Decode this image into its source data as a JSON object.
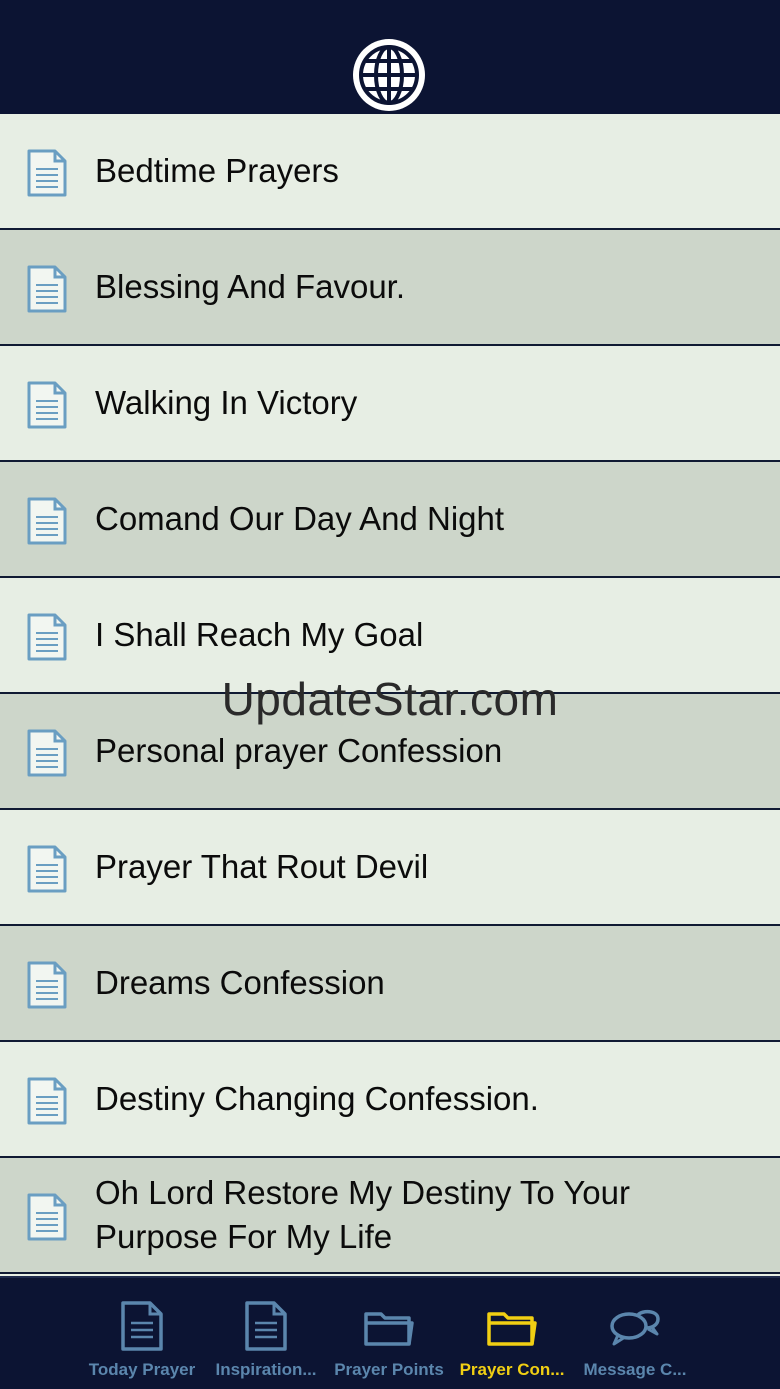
{
  "header": {
    "globe_icon": "globe-icon"
  },
  "watermark": "UpdateStar.com",
  "list": {
    "items": [
      {
        "label": "Bedtime Prayers"
      },
      {
        "label": "Blessing And Favour."
      },
      {
        "label": "Walking In Victory"
      },
      {
        "label": "Comand Our Day And Night"
      },
      {
        "label": "I Shall Reach My Goal"
      },
      {
        "label": "Personal prayer Confession"
      },
      {
        "label": "Prayer That Rout Devil"
      },
      {
        "label": "Dreams Confession"
      },
      {
        "label": "Destiny Changing Confession."
      },
      {
        "label": "Oh Lord Restore My Destiny To Your Purpose For My Life"
      }
    ]
  },
  "tabs": [
    {
      "label": "Today Prayer",
      "icon": "document-icon",
      "active": false
    },
    {
      "label": "Inspiration...",
      "icon": "document-icon",
      "active": false
    },
    {
      "label": "Prayer Points",
      "icon": "folder-icon",
      "active": false
    },
    {
      "label": "Prayer Con...",
      "icon": "folder-icon",
      "active": true
    },
    {
      "label": "Message C...",
      "icon": "chat-bubbles-icon",
      "active": false
    }
  ],
  "colors": {
    "nav_bg": "#0c1433",
    "row_light": "#e7eee4",
    "row_dark": "#cdd6ca",
    "tab_inactive": "#5b86ad",
    "tab_active": "#f1cf13",
    "doc_icon": "#6a9ec2"
  }
}
